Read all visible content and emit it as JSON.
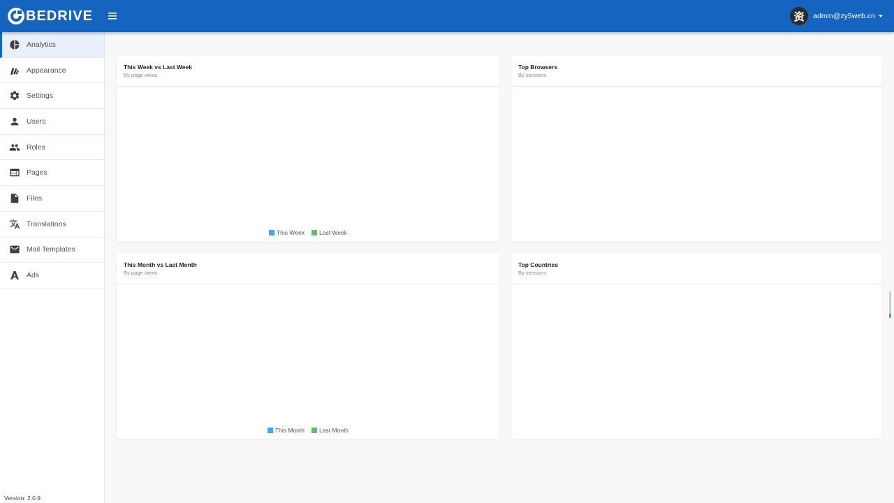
{
  "brand": {
    "name": "BEDRIVE",
    "accent": "#1565c0"
  },
  "header": {
    "menu_icon": "menu-icon",
    "user": {
      "avatar_char": "资",
      "email": "admin@zy5web.cn"
    }
  },
  "sidebar": {
    "items": [
      {
        "label": "Analytics",
        "icon": "pie-chart-icon",
        "active": true
      },
      {
        "label": "Appearance",
        "icon": "paint-swatch-icon"
      },
      {
        "label": "Settings",
        "icon": "gear-icon"
      },
      {
        "label": "Users",
        "icon": "person-icon"
      },
      {
        "label": "Roles",
        "icon": "people-icon"
      },
      {
        "label": "Pages",
        "icon": "web-page-icon"
      },
      {
        "label": "Files",
        "icon": "file-icon"
      },
      {
        "label": "Translations",
        "icon": "translate-icon"
      },
      {
        "label": "Mail Templates",
        "icon": "mail-icon"
      },
      {
        "label": "Ads",
        "icon": "ads-icon"
      }
    ],
    "version": "Version: 2.0.9"
  },
  "panels": {
    "week": {
      "title": "This Week vs Last Week",
      "subtitle": "By page views",
      "legend": [
        {
          "label": "This Week",
          "color": "#42a5f5"
        },
        {
          "label": "Last Week",
          "color": "#66bb6a"
        }
      ]
    },
    "browsers": {
      "title": "Top Browsers",
      "subtitle": "By sessions"
    },
    "month": {
      "title": "This Month vs Last Month",
      "subtitle": "By page views",
      "legend": [
        {
          "label": "This Month",
          "color": "#42a5f5"
        },
        {
          "label": "Last Month",
          "color": "#66bb6a"
        }
      ]
    },
    "countries": {
      "title": "Top Countries",
      "subtitle": "By sessions"
    }
  }
}
